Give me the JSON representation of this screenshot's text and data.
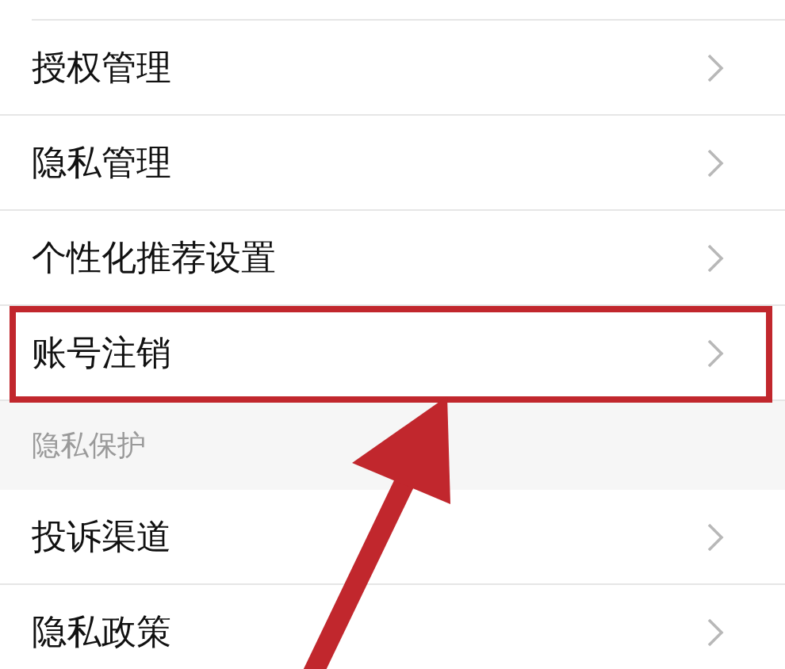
{
  "sections": [
    {
      "items": [
        {
          "label": "授权管理",
          "highlighted": false
        },
        {
          "label": "隐私管理",
          "highlighted": false
        },
        {
          "label": "个性化推荐设置",
          "highlighted": false
        },
        {
          "label": "账号注销",
          "highlighted": true
        }
      ]
    },
    {
      "header": "隐私保护",
      "items": [
        {
          "label": "投诉渠道",
          "highlighted": false
        },
        {
          "label": "隐私政策",
          "highlighted": false
        }
      ]
    }
  ],
  "annotation_arrow": true
}
